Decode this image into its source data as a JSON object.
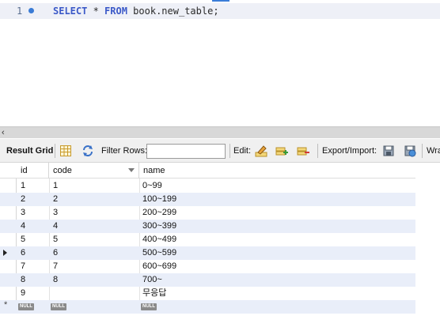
{
  "editor": {
    "line_number": "1",
    "sql_keyword_select": "SELECT",
    "sql_star": " * ",
    "sql_keyword_from": "FROM",
    "sql_table": " book.new_table;"
  },
  "toolbar": {
    "result_grid_label": "Result Grid",
    "filter_rows_label": "Filter Rows:",
    "filter_rows_value": "",
    "edit_label": "Edit:",
    "export_import_label": "Export/Import:",
    "wrap_label": "Wra"
  },
  "grid": {
    "columns": [
      "id",
      "code",
      "name"
    ],
    "rows": [
      [
        "1",
        "1",
        "0~99"
      ],
      [
        "2",
        "2",
        "100~199"
      ],
      [
        "3",
        "3",
        "200~299"
      ],
      [
        "4",
        "4",
        "300~399"
      ],
      [
        "5",
        "5",
        "400~499"
      ],
      [
        "6",
        "6",
        "500~599"
      ],
      [
        "7",
        "7",
        "600~699"
      ],
      [
        "8",
        "8",
        "700~"
      ],
      [
        "9",
        "",
        "무응답"
      ]
    ],
    "new_row_marker": "*",
    "null_label": "NULL",
    "selected_row_index": 5
  },
  "colors": {
    "row_alt": "#e9eef9",
    "keyword": "#3b59c8",
    "null_badge": "#8a8a8a"
  }
}
